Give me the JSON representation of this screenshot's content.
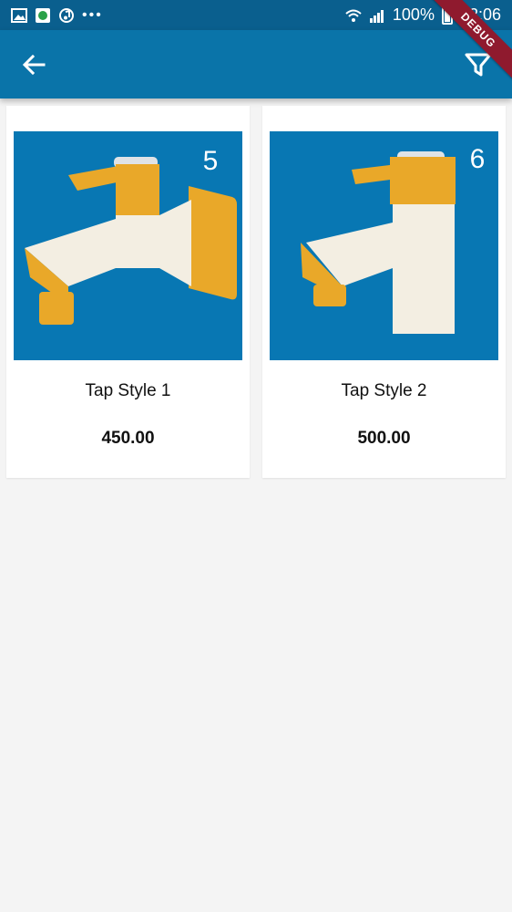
{
  "status_bar": {
    "battery_percent": "100%",
    "time": "12:06",
    "more_indicator": "•••",
    "icons": [
      "gallery-icon",
      "app-notification-icon",
      "music-icon",
      "wifi-icon",
      "signal-icon",
      "battery-icon"
    ]
  },
  "app_bar": {
    "back_icon": "arrow-left-icon",
    "filter_icon": "filter-icon",
    "background": "#0a74a9"
  },
  "debug_banner": "DEBUG",
  "products": [
    {
      "name": "Tap Style 1",
      "price": "450.00",
      "badge_number": "5"
    },
    {
      "name": "Tap Style 2",
      "price": "500.00",
      "badge_number": "6"
    }
  ],
  "colors": {
    "status_bar": "#0a5f8e",
    "image_bg": "#0877b3",
    "tap_yellow": "#e9a829",
    "tap_cream": "#f3eee2"
  }
}
